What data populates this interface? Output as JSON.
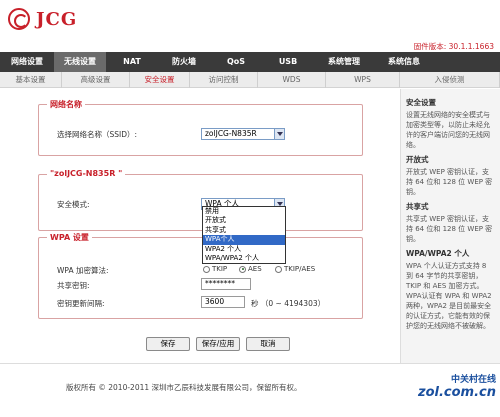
{
  "brand": {
    "logo_text": "JCG",
    "firmware": "固件版本: 30.1.1.1663"
  },
  "mainnav": [
    {
      "label": "网络设置",
      "w": 54
    },
    {
      "label": "无线设置",
      "w": 52,
      "active": true
    },
    {
      "label": "NAT",
      "w": 52
    },
    {
      "label": "防火墙",
      "w": 52
    },
    {
      "label": "QoS",
      "w": 52
    },
    {
      "label": "USB",
      "w": 52
    },
    {
      "label": "系统管理",
      "w": 60
    },
    {
      "label": "系统信息",
      "w": 60
    }
  ],
  "subnav": [
    {
      "label": "基本设置",
      "w": 62
    },
    {
      "label": "高级设置",
      "w": 68
    },
    {
      "label": "安全设置",
      "w": 60,
      "active": true
    },
    {
      "label": "访问控制",
      "w": 68
    },
    {
      "label": "WDS",
      "w": 68
    },
    {
      "label": "WPS",
      "w": 74
    },
    {
      "label": "入侵侦测",
      "w": 100
    }
  ],
  "network": {
    "legend": "网络名称",
    "ssid_label": "选择网络名称（SSID）:",
    "ssid_value": "zolJCG-N835R"
  },
  "security": {
    "legend": "\"zolJCG-N835R \"",
    "mode_label": "安全模式:",
    "mode_value": "WPA 个人",
    "options": [
      "禁用",
      "开放式",
      "共享式",
      "WPA个人",
      "WPA2 个人",
      "WPA/WPA2 个人"
    ],
    "selected_index": 3
  },
  "wpa": {
    "legend": "WPA 设置",
    "cipher_label": "WPA 加密算法:",
    "cipher_options": [
      "TKIP",
      "AES",
      "TKIP/AES"
    ],
    "cipher_selected": "AES",
    "key_label": "共享密钥:",
    "key_value": "********",
    "interval_label": "密钥更新间隔:",
    "interval_value": "3600",
    "interval_hint": "秒 （0 ~ 4194303）"
  },
  "buttons": {
    "save": "保存",
    "save_apply": "保存/应用",
    "cancel": "取消"
  },
  "sidebar": {
    "sections": [
      {
        "title": "安全设置",
        "text": "设置无线网络的安全模式与加密类型等，以防止未经允许的客户端访问您的无线网络。"
      },
      {
        "title": "开放式",
        "text": "开放式 WEP 密钥认证，支持 64 位和 128 位 WEP 密钥。"
      },
      {
        "title": "共享式",
        "text": "共享式 WEP 密钥认证，支持 64 位和 128 位 WEP 密钥。"
      },
      {
        "title": "WPA/WPA2 个人",
        "text": "WPA 个人认证方式支持 8 到 64 字节的共享密钥，TKIP 和 AES 加密方式。WPA认证有 WPA 和 WPA2 两种，WPA2 是目前最安全的认证方式，它能有效的保护您的无线网络不被破解。"
      }
    ]
  },
  "footer": {
    "copyright": "版权所有 © 2010-2011 深圳市乙辰科技发展有限公司，保留所有权。"
  },
  "watermark": {
    "line1": "中关村在线",
    "line2": "zol.com.cn"
  }
}
